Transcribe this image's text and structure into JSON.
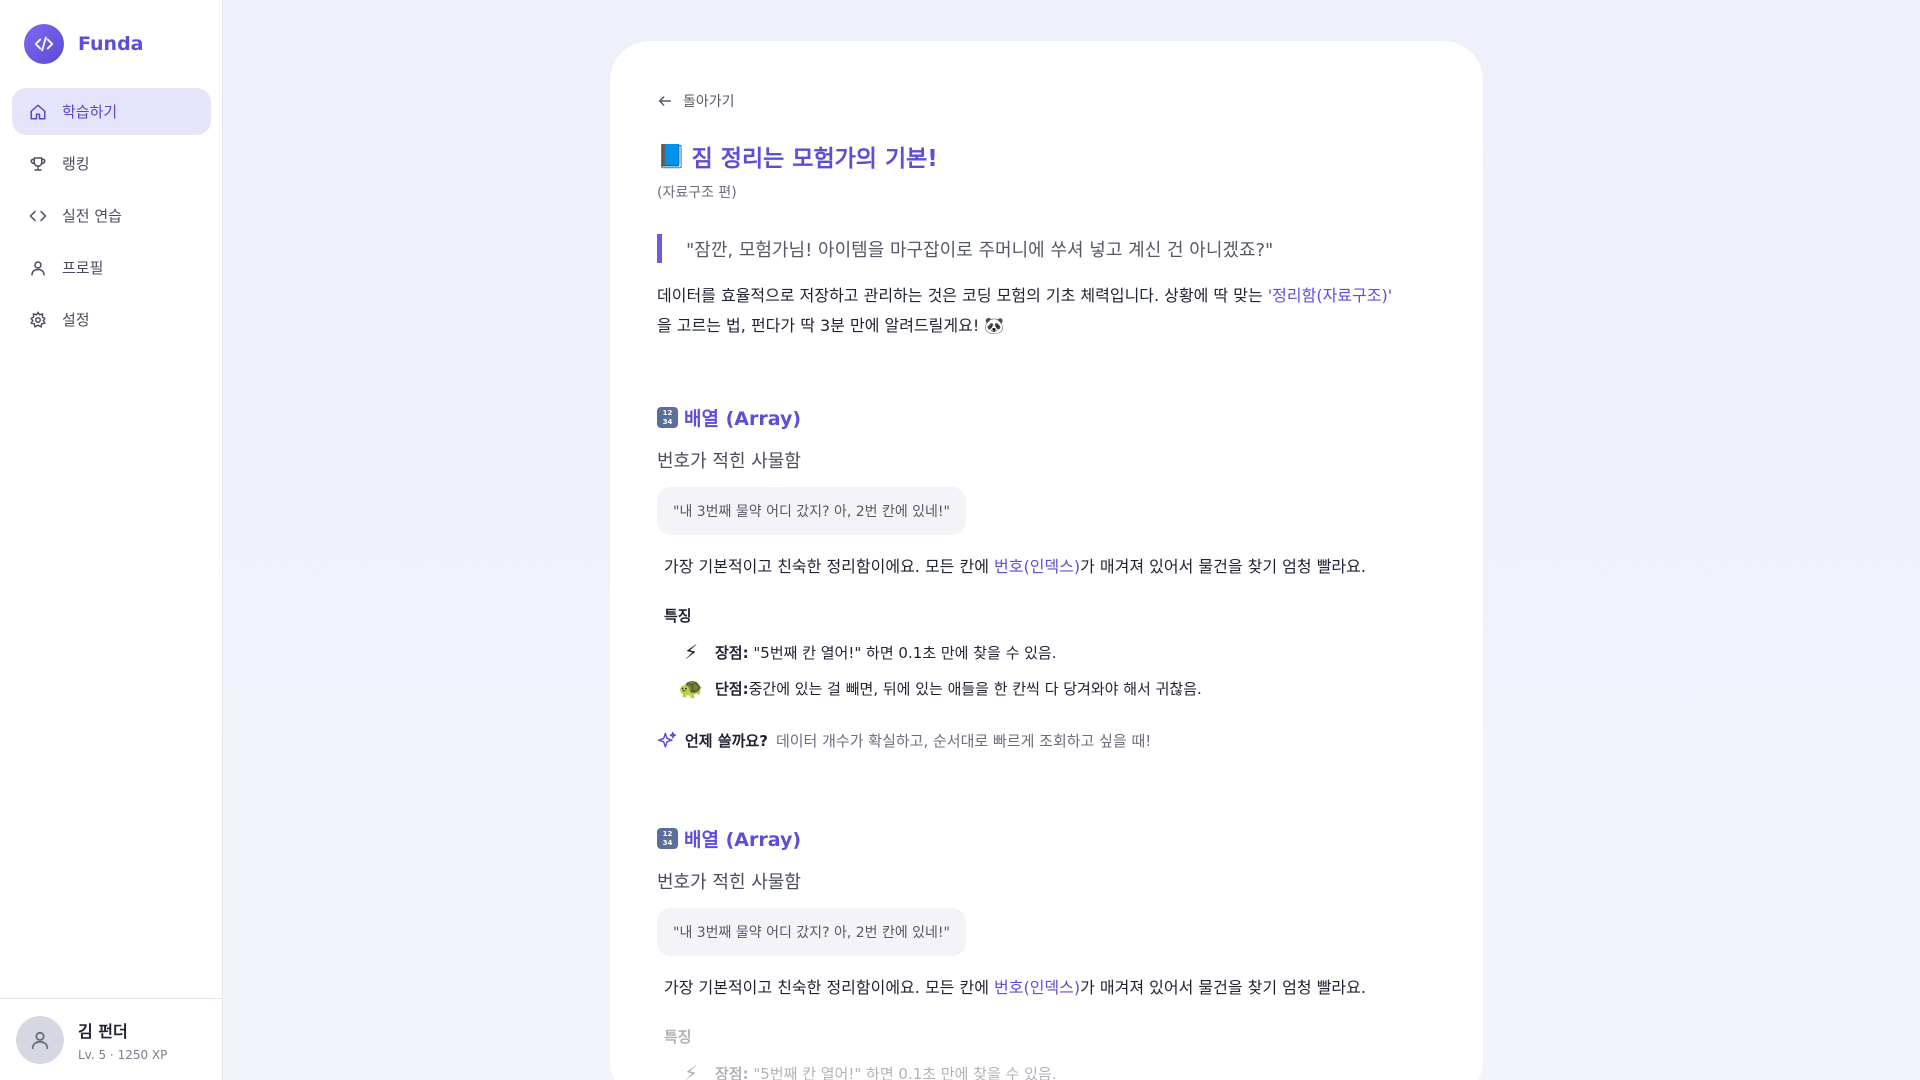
{
  "app": {
    "name": "Funda",
    "accent": "#5d4ed8"
  },
  "sidebar": {
    "items": [
      {
        "label": "학습하기",
        "icon": "home-icon",
        "active": true
      },
      {
        "label": "랭킹",
        "icon": "trophy-icon",
        "active": false
      },
      {
        "label": "실전 연습",
        "icon": "code-icon",
        "active": false
      },
      {
        "label": "프로필",
        "icon": "user-icon",
        "active": false
      },
      {
        "label": "설정",
        "icon": "gear-icon",
        "active": false
      }
    ]
  },
  "user": {
    "name": "김 펀더",
    "meta": "Lv. 5 · 1250 XP"
  },
  "lesson": {
    "back_label": "돌아가기",
    "title_emoji": "📘",
    "title": "짐 정리는 모험가의 기본!",
    "subtitle": "(자료구조 편)",
    "quote": "\"잠깐, 모험가님! 아이템을 마구잡이로 주머니에 쑤셔 넣고 계신 건 아니겠죠?\"",
    "intro_part1": "데이터를 효율적으로 저장하고 관리하는 것은 코딩 모험의 기초 체력입니다. 상황에 딱 맞는 ",
    "intro_highlight": "'정리함(자료구조)'",
    "intro_part2": "을 고르는 법, 펀다가 딱 3분 만에 알려드릴게요! 🐼"
  },
  "sections": [
    {
      "title": "배열 (Array)",
      "subtitle": "번호가 적힌 사물함",
      "bubble": "\"내 3번째 물약 어디 갔지? 아, 2번 칸에 있네!\"",
      "desc_part1": "가장 기본적이고 친숙한 정리함이에요. 모든 칸에 ",
      "desc_highlight": "번호(인덱스)",
      "desc_part2": "가 매겨져 있어서 물건을 찾기 엄청 빨라요.",
      "features_label": "특징",
      "features": [
        {
          "icon": "⚡",
          "key": "장점:",
          "text": " \"5번째 칸 열어!\" 하면 0.1초 만에 찾을 수 있음."
        },
        {
          "icon": "🐢",
          "key": "단점:",
          "text": "중간에 있는 걸 빼면, 뒤에 있는 애들을 한 칸씩 다 당겨와야 해서 귀찮음."
        }
      ],
      "when_label": "언제 쓸까요?",
      "when_text": "데이터 개수가 확실하고, 순서대로 빠르게 조회하고 싶을 때!"
    },
    {
      "title": "배열 (Array)",
      "subtitle": "번호가 적힌 사물함",
      "bubble": "\"내 3번째 물약 어디 갔지? 아, 2번 칸에 있네!\"",
      "desc_part1": "가장 기본적이고 친숙한 정리함이에요. 모든 칸에 ",
      "desc_highlight": "번호(인덱스)",
      "desc_part2": "가 매겨져 있어서 물건을 찾기 엄청 빨라요.",
      "features_label": "특징",
      "features": [
        {
          "icon": "⚡",
          "key": "장점:",
          "text": " \"5번째 칸 열어!\" 하면 0.1초 만에 찾을 수 있음."
        }
      ]
    }
  ]
}
